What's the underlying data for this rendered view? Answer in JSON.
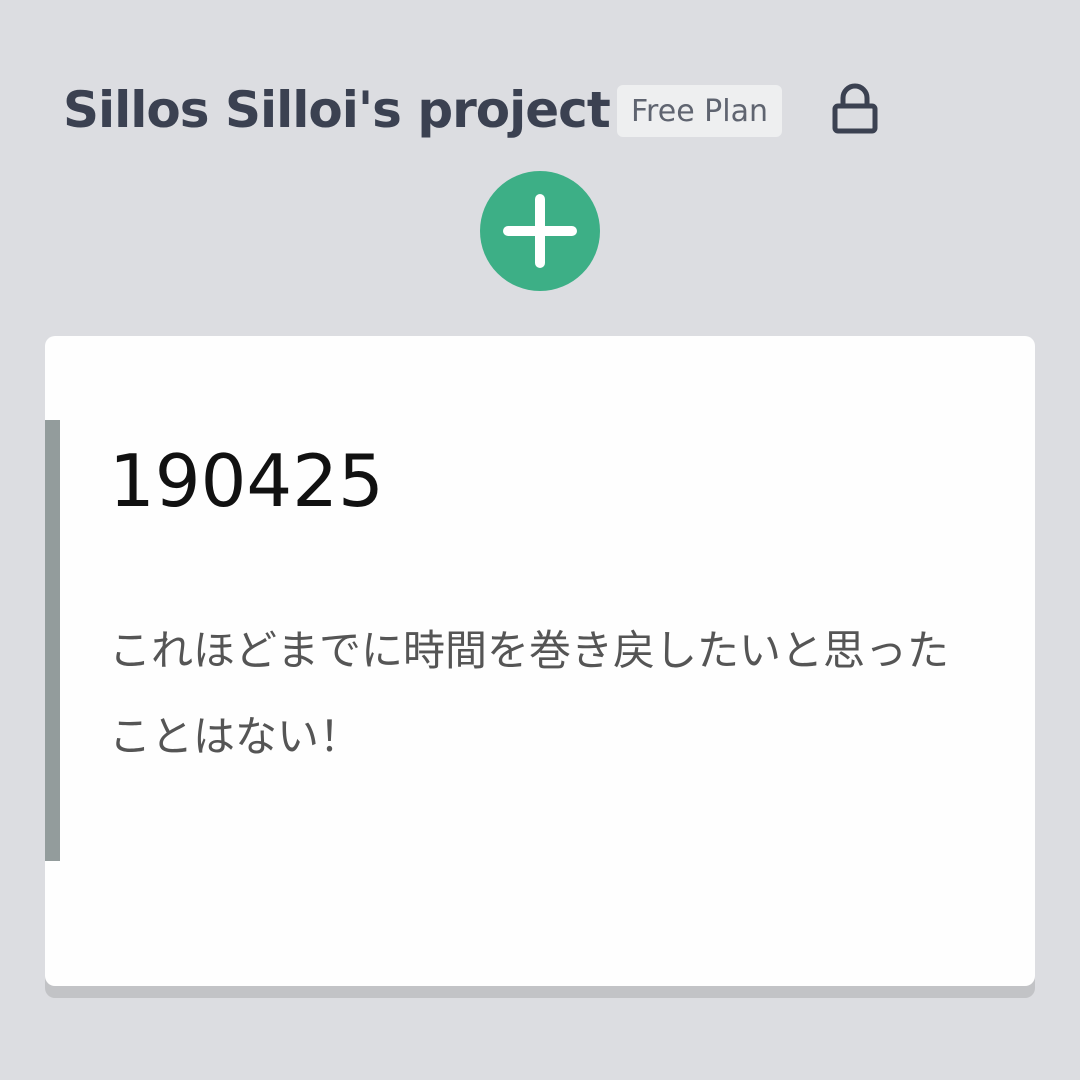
{
  "header": {
    "project_title": "Sillos Silloi's project",
    "plan_badge": "Free Plan",
    "lock_icon": "lock-icon"
  },
  "actions": {
    "add_icon": "plus-icon",
    "add_color": "#3daf86"
  },
  "note": {
    "title": "190425",
    "body": "これほどまでに時間を巻き戻したいと思ったことはない！",
    "accent_color": "#939c9c"
  }
}
